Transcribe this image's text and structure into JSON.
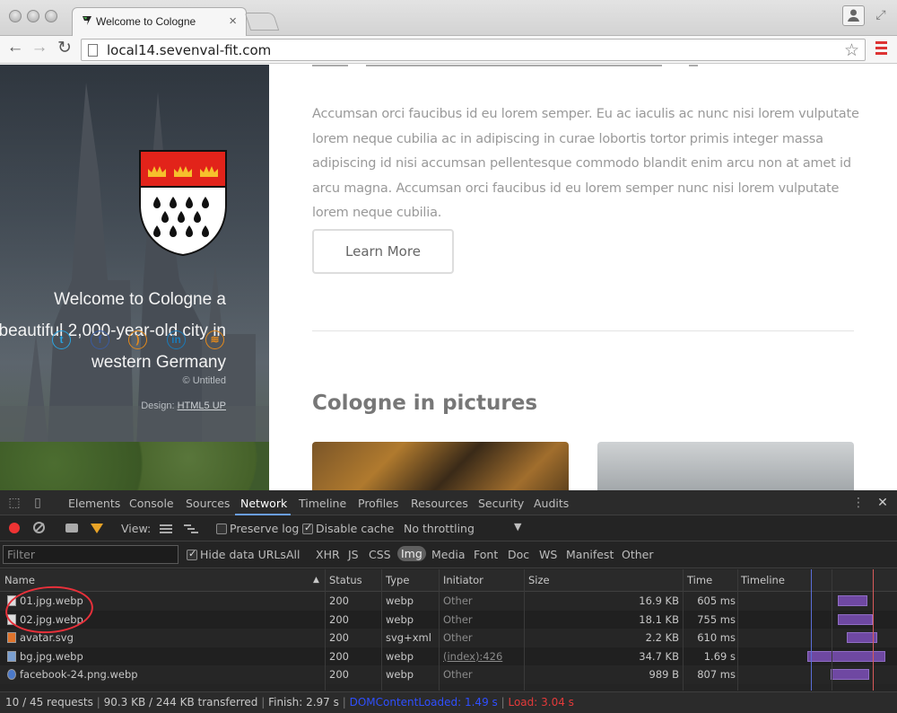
{
  "browser": {
    "tab_title": "Welcome to Cologne",
    "url": "local14.sevenval-fit.com"
  },
  "sidebar": {
    "intro_text": "Welcome to Cologne a beautiful 2,000-year-old city in western Germany",
    "copyright": "© Untitled",
    "design_prefix": "Design: ",
    "design_link": "HTML5 UP",
    "social_icons": [
      "twitter-icon",
      "facebook-icon",
      "rss-icon",
      "linkedin-icon",
      "feed-icon"
    ]
  },
  "main": {
    "paragraph": "Accumsan orci faucibus id eu lorem semper. Eu ac iaculis ac nunc nisi lorem vulputate lorem neque cubilia ac in adipiscing in curae lobortis tortor primis integer massa adipiscing id nisi accumsan pellentesque commodo blandit enim arcu non at amet id arcu magna. Accumsan orci faucibus id eu lorem semper nunc nisi lorem vulputate lorem neque cubilia.",
    "learn_more": "Learn More",
    "pictures_title": "Cologne in pictures"
  },
  "devtools": {
    "tabs": [
      "Elements",
      "Console",
      "Sources",
      "Network",
      "Timeline",
      "Profiles",
      "Resources",
      "Security",
      "Audits"
    ],
    "active_tab": "Network",
    "view_label": "View:",
    "preserve_log": "Preserve log",
    "disable_cache": "Disable cache",
    "throttling": "No throttling",
    "filter_placeholder": "Filter",
    "hide_data_urls": "Hide data URLs",
    "type_filters": [
      "All",
      "XHR",
      "JS",
      "CSS",
      "Img",
      "Media",
      "Font",
      "Doc",
      "WS",
      "Manifest",
      "Other"
    ],
    "active_type": "Img",
    "columns": [
      "Name",
      "Status",
      "Type",
      "Initiator",
      "Size",
      "Time",
      "Timeline"
    ],
    "rows": [
      {
        "name": "01.jpg.webp",
        "status": "200",
        "type": "webp",
        "initiator": "Other",
        "size": "16.9 KB",
        "time": "605 ms"
      },
      {
        "name": "02.jpg.webp",
        "status": "200",
        "type": "webp",
        "initiator": "Other",
        "size": "18.1 KB",
        "time": "755 ms"
      },
      {
        "name": "avatar.svg",
        "status": "200",
        "type": "svg+xml",
        "initiator": "Other",
        "size": "2.2 KB",
        "time": "610 ms"
      },
      {
        "name": "bg.jpg.webp",
        "status": "200",
        "type": "webp",
        "initiator": "(index):426",
        "size": "34.7 KB",
        "time": "1.69 s"
      },
      {
        "name": "facebook-24.png.webp",
        "status": "200",
        "type": "webp",
        "initiator": "Other",
        "size": "989 B",
        "time": "807 ms"
      }
    ],
    "status": {
      "requests": "10 / 45 requests",
      "transferred": "90.3 KB / 244 KB transferred",
      "finish": "Finish: 2.97 s",
      "dom": "DOMContentLoaded: 1.49 s",
      "load": "Load: 3.04 s"
    }
  }
}
